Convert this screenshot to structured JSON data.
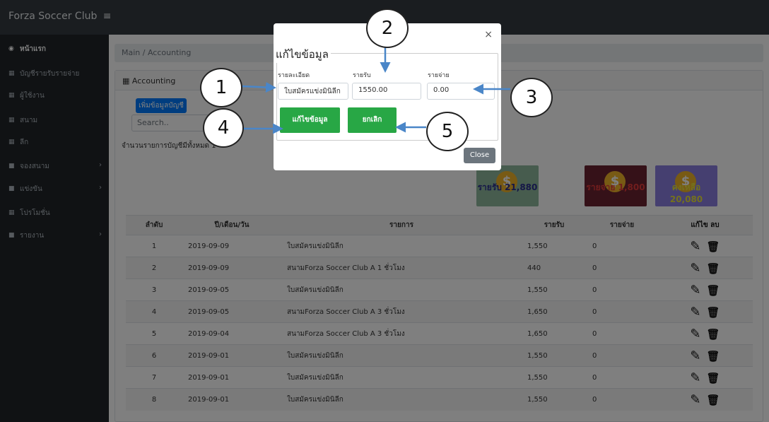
{
  "app": {
    "title": "Forza Soccer Club",
    "menu_glyph": "≡"
  },
  "sidebar": {
    "items": [
      {
        "label": "หน้าแรก",
        "icon": "dashboard-icon",
        "glyph": "◉",
        "has_chevron": false
      },
      {
        "label": "บัญชีรายรับรายจ่าย",
        "icon": "table-icon",
        "glyph": "▦",
        "has_chevron": false
      },
      {
        "label": "ผู้ใช้งาน",
        "icon": "table-icon",
        "glyph": "▦",
        "has_chevron": false
      },
      {
        "label": "สนาม",
        "icon": "table-icon",
        "glyph": "▦",
        "has_chevron": false
      },
      {
        "label": "ลีก",
        "icon": "table-icon",
        "glyph": "▦",
        "has_chevron": false
      },
      {
        "label": "จองสนาม",
        "icon": "folder-icon",
        "glyph": "■",
        "has_chevron": true
      },
      {
        "label": "แข่งขัน",
        "icon": "folder-icon",
        "glyph": "■",
        "has_chevron": true
      },
      {
        "label": "โปรโมชั่น",
        "icon": "table-icon",
        "glyph": "▦",
        "has_chevron": false
      },
      {
        "label": "รายงาน",
        "icon": "folder-icon",
        "glyph": "■",
        "has_chevron": true
      }
    ],
    "chevron": "›"
  },
  "breadcrumb": "Main / Accounting",
  "card": {
    "title": "Accounting",
    "icon_glyph": "▦"
  },
  "add_button": "เพิ่มข้อมูลบัญชี",
  "search": {
    "placeholder": "Search.."
  },
  "record_count_text": "จำนวนรายการบัญชีมีทั้งหมด 1",
  "summary": [
    {
      "label": "รายรับ 21,880",
      "color": "#2a2f8f",
      "bg": "#8fb89c"
    },
    {
      "label": "รายจ่าย 1,800",
      "color": "#e23b3b",
      "bg": "#6a2230"
    },
    {
      "label": "คงเหลือ 20,080",
      "color": "#e8e23a",
      "bg": "#8a7ee0"
    }
  ],
  "table": {
    "headers": [
      "ลำดับ",
      "ปี/เดือน/วัน",
      "รายการ",
      "รายรับ",
      "รายจ่าย",
      "แก้ไข ลบ"
    ],
    "rows": [
      {
        "no": "1",
        "date": "2019-09-09",
        "item": "ใบสมัครแข่งมินิลีก",
        "income": "1,550",
        "expense": "0"
      },
      {
        "no": "2",
        "date": "2019-09-09",
        "item": "สนามForza Soccer Club A 1 ชั่วโมง",
        "income": "440",
        "expense": "0"
      },
      {
        "no": "3",
        "date": "2019-09-05",
        "item": "ใบสมัครแข่งมินิลีก",
        "income": "1,550",
        "expense": "0"
      },
      {
        "no": "4",
        "date": "2019-09-05",
        "item": "สนามForza Soccer Club A 3 ชั่วโมง",
        "income": "1,650",
        "expense": "0"
      },
      {
        "no": "5",
        "date": "2019-09-04",
        "item": "สนามForza Soccer Club A 3 ชั่วโมง",
        "income": "1,650",
        "expense": "0"
      },
      {
        "no": "6",
        "date": "2019-09-01",
        "item": "ใบสมัครแข่งมินิลีก",
        "income": "1,550",
        "expense": "0"
      },
      {
        "no": "7",
        "date": "2019-09-01",
        "item": "ใบสมัครแข่งมินิลีก",
        "income": "1,550",
        "expense": "0"
      },
      {
        "no": "8",
        "date": "2019-09-01",
        "item": "ใบสมัครแข่งมินิลีก",
        "income": "1,550",
        "expense": "0"
      }
    ],
    "edit_glyph": "✎",
    "delete_glyph": "🗑"
  },
  "modal": {
    "close_glyph": "×",
    "legend": "แก้ไขข้อมูล",
    "labels": {
      "detail": "รายละเอียด",
      "income": "รายรับ",
      "expense": "รายจ่าย"
    },
    "values": {
      "detail": "ใบสมัครแข่งมินิลีก",
      "income": "1550.00",
      "expense": "0.00"
    },
    "save_button": "แก้ไขข้อมูล",
    "cancel_button": "ยกเลิก",
    "close_button": "Close"
  },
  "callouts": [
    "1",
    "2",
    "3",
    "4",
    "5"
  ],
  "colors": {
    "topbar": "#343a40",
    "sidebar": "#212529",
    "primary": "#007bff",
    "success": "#28a745",
    "secondary": "#6c757d",
    "arrow": "#4a86c8"
  }
}
